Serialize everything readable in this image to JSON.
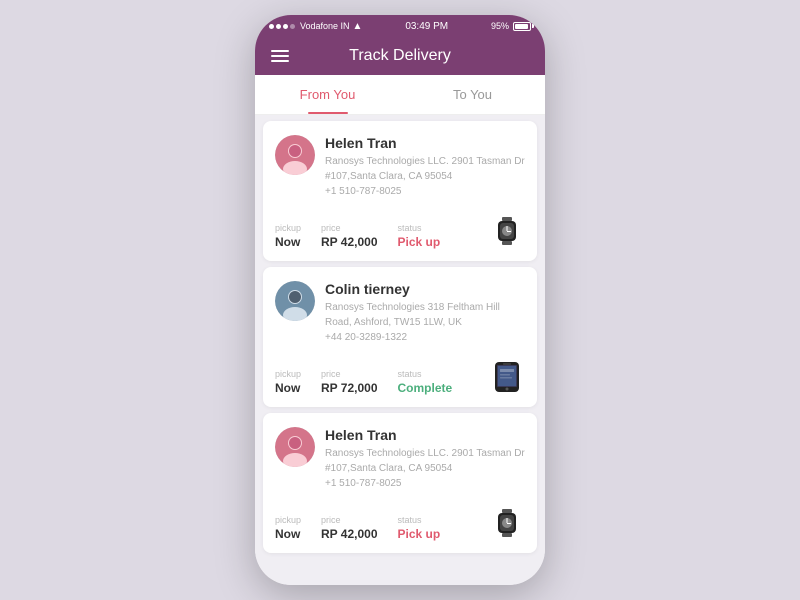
{
  "statusBar": {
    "carrier": "Vodafone IN",
    "time": "03:49 PM",
    "battery": "95%",
    "wifi": true
  },
  "header": {
    "title": "Track Delivery",
    "menuIcon": "menu-icon"
  },
  "tabs": [
    {
      "id": "from-you",
      "label": "From You",
      "active": true
    },
    {
      "id": "to-you",
      "label": "To You",
      "active": false
    }
  ],
  "deliveries": [
    {
      "id": "d1",
      "name": "Helen Tran",
      "address": "Ranosys Technologies LLC. 2901 Tasman Dr #107,Santa Clara, CA 95054",
      "phone": "+1 510-787-8025",
      "pickup": "Now",
      "price": "RP 42,000",
      "status": "Pick up",
      "statusType": "pickup",
      "product": "watch",
      "avatarType": "helen"
    },
    {
      "id": "d2",
      "name": "Colin tierney",
      "address": "Ranosys Technologies 318 Feltham Hill Road, Ashford, TW15 1LW, UK",
      "phone": "+44 20-3289-1322",
      "pickup": "Now",
      "price": "RP 72,000",
      "status": "Complete",
      "statusType": "complete",
      "product": "phone",
      "avatarType": "colin"
    },
    {
      "id": "d3",
      "name": "Helen Tran",
      "address": "Ranosys Technologies LLC. 2901 Tasman Dr #107,Santa Clara, CA 95054",
      "phone": "+1 510-787-8025",
      "pickup": "Now",
      "price": "RP 42,000",
      "status": "Pick up",
      "statusType": "pickup",
      "product": "watch",
      "avatarType": "helen"
    }
  ],
  "labels": {
    "pickup": "pickup",
    "price": "price",
    "status": "status"
  }
}
